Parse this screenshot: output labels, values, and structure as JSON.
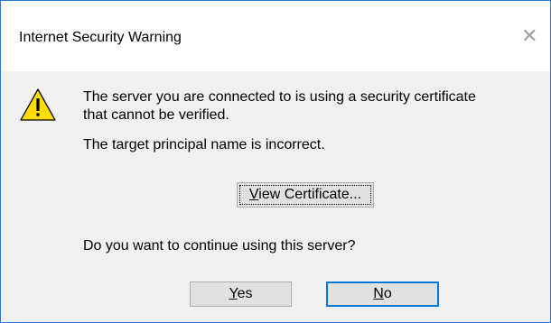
{
  "dialog": {
    "title": "Internet Security Warning",
    "close_glyph": "✕",
    "icon": "warning-icon",
    "message_line1": "The server you are connected to is using a security certificate",
    "message_line2": "that cannot be verified.",
    "detail": "The target principal name is incorrect.",
    "view_certificate": {
      "accel": "V",
      "rest": "iew Certificate..."
    },
    "question": "Do you want to continue using this server?",
    "yes": {
      "accel": "Y",
      "rest": "es"
    },
    "no": {
      "accel": "N",
      "rest": "o"
    }
  },
  "colors": {
    "accent": "#0078d7",
    "warning_fill": "#ffde00",
    "warning_outline": "#000000"
  }
}
